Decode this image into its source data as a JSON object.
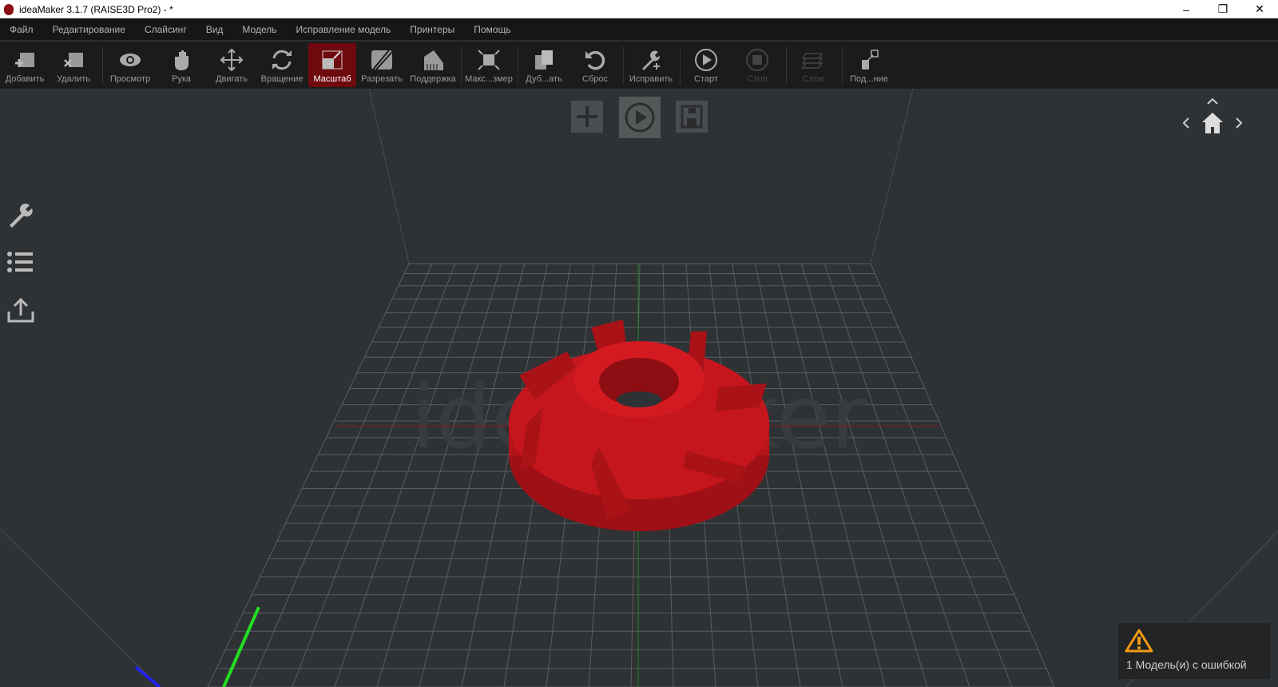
{
  "window": {
    "title": "ideaMaker 3.1.7 (RAISE3D Pro2) - *"
  },
  "menu": [
    "Файл",
    "Редактирование",
    "Слайсинг",
    "Вид",
    "Модель",
    "Исправление модель",
    "Принтеры",
    "Помощь"
  ],
  "toolbar": {
    "add": "Добавить",
    "remove": "Удалить",
    "view": "Просмотр",
    "hand": "Рука",
    "move": "Двигать",
    "rotate": "Вращение",
    "scale": "Масштаб",
    "cut": "Разрезать",
    "support": "Поддержка",
    "maxsize": "Макс...змер",
    "duplicate": "Дуб...ать",
    "reset": "Сброс",
    "repair": "Исправить",
    "start": "Старт",
    "stop": "Стоп",
    "layers": "Слои",
    "connect": "Под...ние"
  },
  "viewport": {
    "watermark": "ideaMaker"
  },
  "notification": {
    "text": "1 Модель(и) с ошибкой",
    "icon": "warning-icon"
  },
  "colors": {
    "accent": "#6e0a0e",
    "model": "#c4161c",
    "warning": "#f39c12"
  }
}
